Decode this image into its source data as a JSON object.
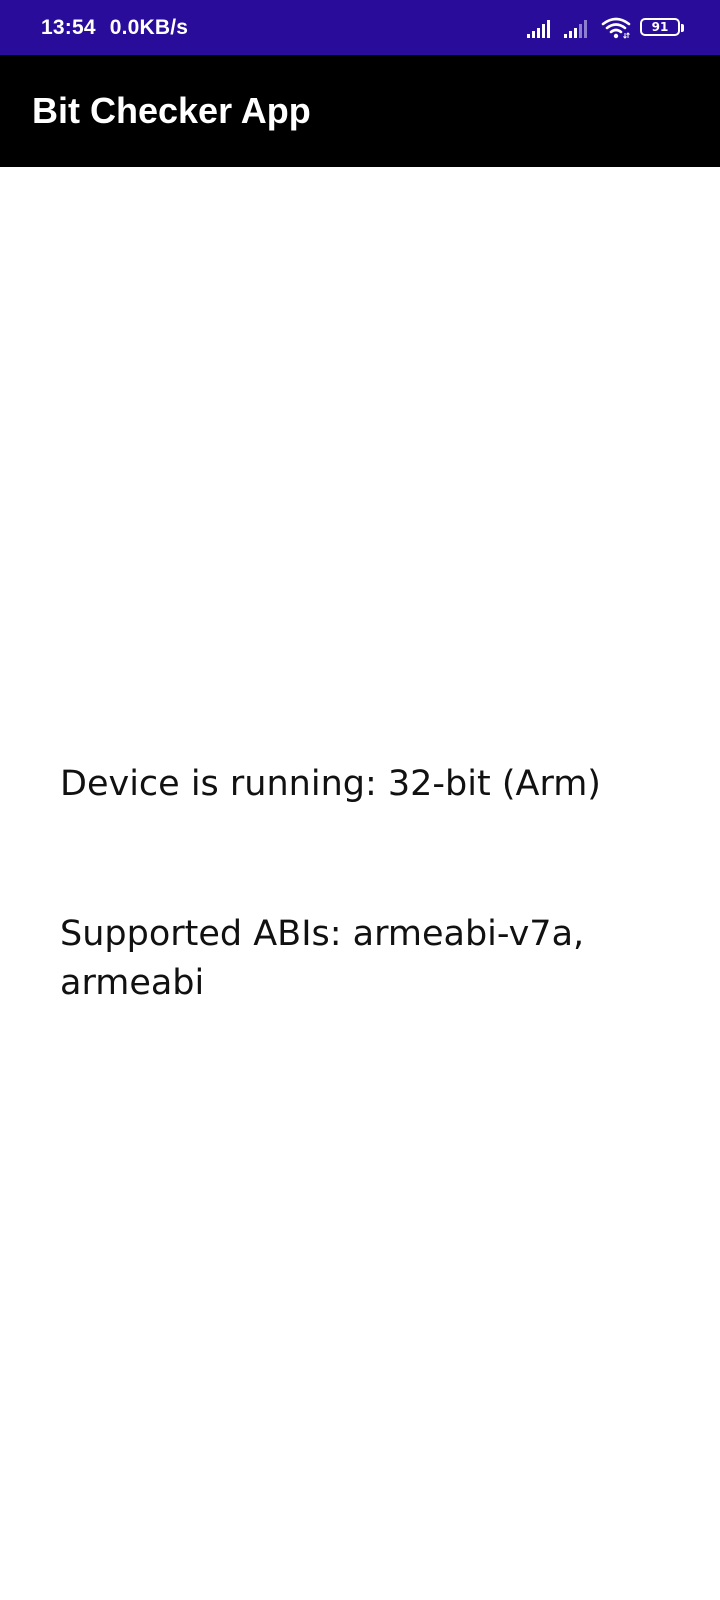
{
  "status_bar": {
    "time": "13:54",
    "network_speed": "0.0KB/s",
    "icons": [
      "signal-icon",
      "signal-icon",
      "wifi-icon",
      "battery-icon"
    ],
    "battery_level": "91",
    "background_color": "#2a0c9a"
  },
  "app_bar": {
    "title": "Bit Checker App",
    "background_color": "#000000"
  },
  "content": {
    "running_text": "Device is running: 32-bit (Arm)",
    "abis_text": "Supported ABIs: armeabi-v7a, armeabi"
  }
}
